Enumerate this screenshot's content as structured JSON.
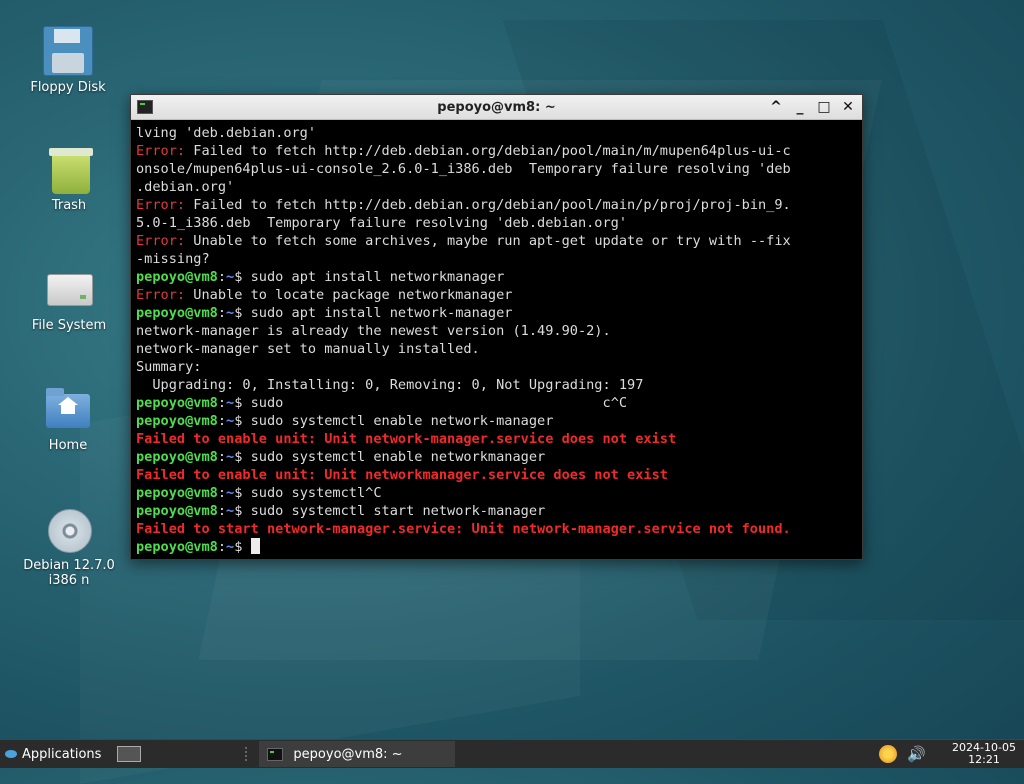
{
  "desktop": {
    "icons": [
      {
        "label": "Floppy Disk",
        "icon": "floppy-disk-icon"
      },
      {
        "label": "Trash",
        "icon": "trash-icon"
      },
      {
        "label": "File System",
        "icon": "file-system-icon"
      },
      {
        "label": "Home",
        "icon": "home-folder-icon"
      },
      {
        "label": "Debian 12.7.0 i386 n",
        "icon": "cd-disc-icon"
      }
    ]
  },
  "window": {
    "title": "pepoyo@vm8: ~",
    "buttons": {
      "shade": "^",
      "minimize": "_",
      "maximize": "□",
      "close": "✕"
    }
  },
  "terminal": {
    "prompt_user": "pepoyo@vm8",
    "prompt_sep": ":",
    "prompt_path": "~",
    "prompt_dollar": "$ ",
    "lines": [
      {
        "type": "plain",
        "text": "lving 'deb.debian.org'"
      },
      {
        "type": "error",
        "label": "Error:",
        "text": " Failed to fetch http://deb.debian.org/debian/pool/main/m/mupen64plus-ui-c"
      },
      {
        "type": "plain",
        "text": "onsole/mupen64plus-ui-console_2.6.0-1_i386.deb  Temporary failure resolving 'deb"
      },
      {
        "type": "plain",
        "text": ".debian.org'"
      },
      {
        "type": "error",
        "label": "Error:",
        "text": " Failed to fetch http://deb.debian.org/debian/pool/main/p/proj/proj-bin_9."
      },
      {
        "type": "plain",
        "text": "5.0-1_i386.deb  Temporary failure resolving 'deb.debian.org'"
      },
      {
        "type": "error",
        "label": "Error:",
        "text": " Unable to fetch some archives, maybe run apt-get update or try with --fix"
      },
      {
        "type": "plain",
        "text": "-missing?"
      },
      {
        "type": "prompt",
        "text": "sudo apt install networkmanager"
      },
      {
        "type": "error",
        "label": "Error:",
        "text": " Unable to locate package networkmanager"
      },
      {
        "type": "prompt",
        "text": "sudo apt install network-manager"
      },
      {
        "type": "plain",
        "text": "network-manager is already the newest version (1.49.90-2)."
      },
      {
        "type": "plain",
        "text": "network-manager set to manually installed."
      },
      {
        "type": "plain",
        "text": "Summary:"
      },
      {
        "type": "plain",
        "text": "  Upgrading: 0, Installing: 0, Removing: 0, Not Upgrading: 197"
      },
      {
        "type": "prompt",
        "text": "sudo                                       c^C"
      },
      {
        "type": "prompt",
        "text": "sudo systemctl enable network-manager"
      },
      {
        "type": "fail",
        "text": "Failed to enable unit: Unit network-manager.service does not exist"
      },
      {
        "type": "prompt",
        "text": "sudo systemctl enable networkmanager"
      },
      {
        "type": "fail",
        "text": "Failed to enable unit: Unit networkmanager.service does not exist"
      },
      {
        "type": "prompt",
        "text": "sudo systemctl^C"
      },
      {
        "type": "prompt",
        "text": "sudo systemctl start network-manager"
      },
      {
        "type": "fail",
        "text": "Failed to start network-manager.service: Unit network-manager.service not found."
      },
      {
        "type": "prompt",
        "text": "",
        "cursor": true
      }
    ]
  },
  "taskbar": {
    "applications_label": "Applications",
    "task_label": "pepoyo@vm8: ~",
    "clock_date": "2024-10-05",
    "clock_time": "12:21"
  }
}
